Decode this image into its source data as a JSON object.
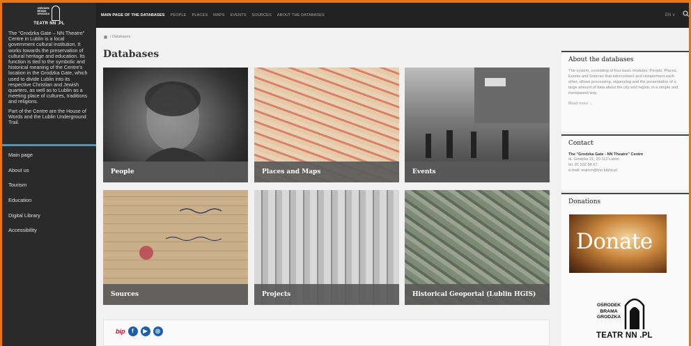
{
  "brand": {
    "logo_lines": [
      "OŚRODEK",
      "BRAMA",
      "GRODZKA"
    ],
    "name": "TEATR NN .PL"
  },
  "sidebar": {
    "about": [
      "The \"Grodzka Gate – NN Theatre\" Centre in Lublin is a local government cultural institution. It works towards the preservation of cultural heritage and education. Its function is tied to the symbolic and historical meaning of the Centre's location in the Grodzka Gate, which used to divide Lublin into its respective Christian and Jewish quarters, as well as to Lublin as a meeting place of cultures, traditions and religions.",
      "Part of the Centre are the House of Words and the Lublin Underground Trail."
    ],
    "nav": [
      {
        "label": "Main page"
      },
      {
        "label": "About us"
      },
      {
        "label": "Tourism"
      },
      {
        "label": "Education"
      },
      {
        "label": "Digital Library"
      },
      {
        "label": "Accessibility"
      }
    ]
  },
  "topnav": {
    "items": [
      {
        "label": "MAIN PAGE OF THE DATABASES",
        "active": true
      },
      {
        "label": "PEOPLE"
      },
      {
        "label": "PLACES"
      },
      {
        "label": "MAPS"
      },
      {
        "label": "EVENTS"
      },
      {
        "label": "SOURCES"
      },
      {
        "label": "ABOUT THE DATABASES"
      }
    ],
    "lang": "EN ∨"
  },
  "main": {
    "breadcrumb": "/ Databases",
    "title": "Databases",
    "tiles": [
      {
        "label": "People"
      },
      {
        "label": "Places and Maps"
      },
      {
        "label": "Events"
      },
      {
        "label": "Sources"
      },
      {
        "label": "Projects"
      },
      {
        "label": "Historical Geoportal (Lublin HGIS)"
      }
    ],
    "footer": {
      "bip": "bip"
    }
  },
  "right": {
    "about": {
      "title": "About the databases",
      "text": "The system, consisting of four basic modules: People, Places, Events and Sources that interconnect and complement each other, allows processing, organizing and the presentation of a large amount of data about the city and region, in a simple and transparent way.",
      "more": "Read more →"
    },
    "contact": {
      "title": "Contact",
      "name": "The \"Grodzka Gate - NN Theatre\" Centre",
      "address": "ul. Grodzka 21, 20-112 Lublin",
      "phone": "tel. 81 532 58 67",
      "email": "e-mail: teatrnn@tnn.lublin.pl"
    },
    "donations": {
      "title": "Donations",
      "donate": "Donate"
    }
  },
  "colors": {
    "frame": "#e87414",
    "accent": "#34a3c9",
    "bip": "#c8102e",
    "social": "#1d5fa8"
  }
}
